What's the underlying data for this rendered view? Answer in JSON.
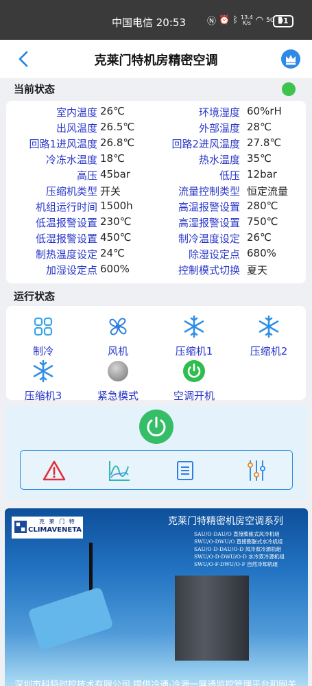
{
  "statusbar": {
    "carrier_time": "中国电信 20:53",
    "speed_top": "13.4",
    "speed_bottom": "K/s",
    "network": "5G",
    "battery": "91"
  },
  "header": {
    "title": "克莱门特机房精密空调"
  },
  "current": {
    "label": "当前状态",
    "status_color": "#3cc44c",
    "params": [
      {
        "l_label": "室内温度",
        "l_value": "26℃",
        "r_label": "环境湿度",
        "r_value": "60%rH"
      },
      {
        "l_label": "出风温度",
        "l_value": "26.5℃",
        "r_label": "外部温度",
        "r_value": "28℃"
      },
      {
        "l_label": "回路1进风温度",
        "l_value": "26.8℃",
        "r_label": "回路2进风温度",
        "r_value": "27.8℃"
      },
      {
        "l_label": "冷冻水温度",
        "l_value": "18℃",
        "r_label": "热水温度",
        "r_value": "35℃"
      },
      {
        "l_label": "高压",
        "l_value": "45bar",
        "r_label": "低压",
        "r_value": "12bar"
      },
      {
        "l_label": "压缩机类型",
        "l_value": "开关",
        "r_label": "流量控制类型",
        "r_value": "恒定流量"
      },
      {
        "l_label": "机组运行时间",
        "l_value": "1500h",
        "r_label": "高温报警设置",
        "r_value": "280℃"
      },
      {
        "l_label": "低温报警设置",
        "l_value": "230℃",
        "r_label": "高湿报警设置",
        "r_value": "750℃"
      },
      {
        "l_label": "低湿报警设置",
        "l_value": "450℃",
        "r_label": "制冷温度设定",
        "r_value": "26℃"
      },
      {
        "l_label": "制热温度设定",
        "l_value": "24℃",
        "r_label": "除湿设定点",
        "r_value": "680%"
      },
      {
        "l_label": "加湿设定点",
        "l_value": "600%",
        "r_label": "控制模式切换",
        "r_value": "夏天"
      }
    ]
  },
  "running": {
    "label": "运行状态",
    "items": [
      {
        "label": "制冷",
        "icon": "grid-icon"
      },
      {
        "label": "风机",
        "icon": "fan-icon"
      },
      {
        "label": "压缩机1",
        "icon": "snowflake-icon"
      },
      {
        "label": "压缩机2",
        "icon": "snowflake-icon"
      },
      {
        "label": "压缩机3",
        "icon": "snowflake-icon"
      },
      {
        "label": "紧急模式",
        "icon": "gray-circle-icon"
      },
      {
        "label": "空调开机",
        "icon": "power-icon"
      }
    ]
  },
  "toolbar": {
    "icons": [
      "alarm-icon",
      "chart-icon",
      "list-icon",
      "settings-sliders-icon"
    ]
  },
  "banner": {
    "logo_cn": "克 莱 门 特",
    "logo_en": "CLIMAVENETA",
    "title": "克莱门特精密机房空调系列",
    "lines": [
      "SAU/O-DAU/O 直接膨胀式风冷机组",
      "SWU/O-DWU/O 直接膨胀式水冷机组",
      "SAU/O-D-DAU/O-D 风冷双冷源机组",
      "SWU/O-D-DWU/O-D 水冷双冷源机组",
      "SWU/O-F-DWU/O-F 自然冷却机组"
    ],
    "footer": "深圳市科特时控技术有限公司   提供冷通·冷源一屏通监控管理平台和网关"
  }
}
